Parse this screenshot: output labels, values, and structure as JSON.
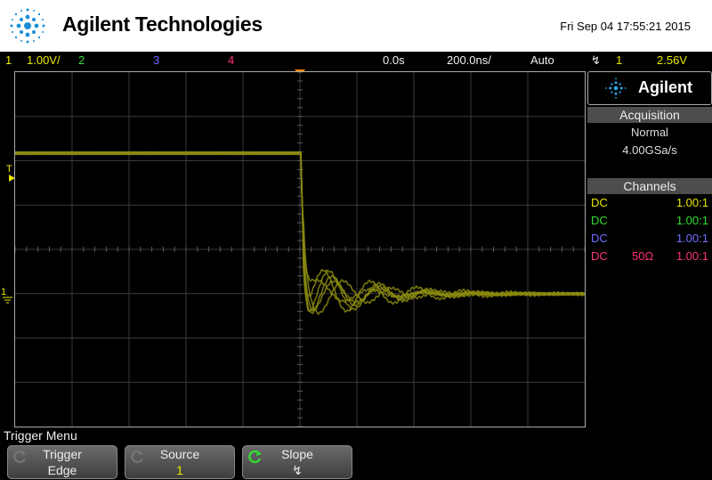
{
  "header": {
    "brand": "Agilent Technologies",
    "datetime": "Fri Sep 04 17:55:21 2015"
  },
  "status": {
    "ch1_num": "1",
    "ch1_scale": "1.00V/",
    "ch2_num": "2",
    "ch3_num": "3",
    "ch4_num": "4",
    "time_offset": "0.0s",
    "time_scale": "200.0ns/",
    "trigger_mode": "Auto",
    "trigger_slope_glyph": "↯",
    "trigger_source": "1",
    "trigger_level": "2.56V"
  },
  "markers": {
    "trigger_level_label": "T",
    "ch1_ground_label": "1",
    "ch1_right_label": "1"
  },
  "side_panel": {
    "logo_text": "Agilent",
    "acquisition": {
      "header": "Acquisition",
      "mode": "Normal",
      "rate": "4.00GSa/s"
    },
    "channels": {
      "header": "Channels",
      "rows": [
        {
          "coupling": "DC",
          "impedance": "",
          "probe": "1.00:1"
        },
        {
          "coupling": "DC",
          "impedance": "",
          "probe": "1.00:1"
        },
        {
          "coupling": "DC",
          "impedance": "",
          "probe": "1.00:1"
        },
        {
          "coupling": "DC",
          "impedance": "50Ω",
          "probe": "1.00:1"
        }
      ]
    }
  },
  "menu": {
    "title": "Trigger Menu",
    "softkeys": [
      {
        "label": "Trigger",
        "value": "Edge"
      },
      {
        "label": "Source",
        "value": "1"
      },
      {
        "label": "Slope",
        "value": "↯"
      }
    ]
  },
  "colors": {
    "ch1": "#e8e800",
    "ch2": "#33dd33",
    "ch3": "#6f6fff",
    "ch4": "#ff3377",
    "trace": "#8a8a10",
    "trigger_marker": "#ff8c00",
    "grid": "#3a3a3a"
  }
}
